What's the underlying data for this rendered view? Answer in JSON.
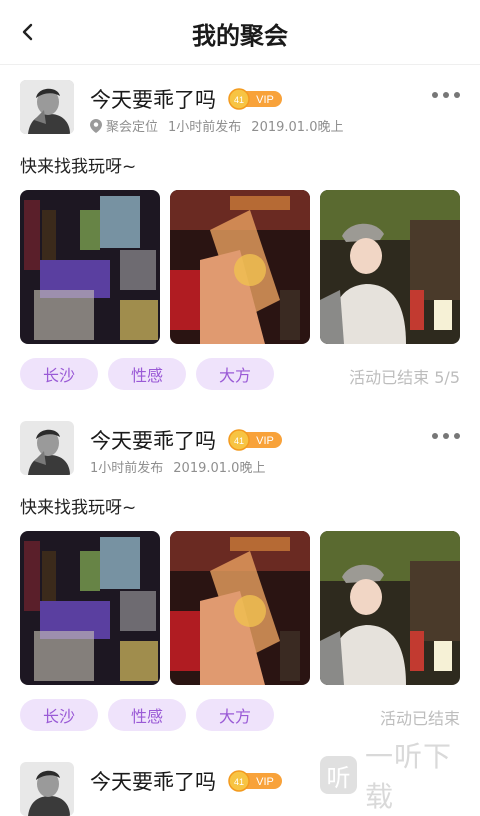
{
  "header": {
    "title": "我的聚会"
  },
  "posts": [
    {
      "name": "今天要乖了吗",
      "vip_label": "VIP",
      "vip_level": "41",
      "location": "聚会定位",
      "time": "1小时前发布",
      "date": "2019.01.0晚上",
      "text": "快来找我玩呀~",
      "tags": [
        "长沙",
        "性感",
        "大方"
      ],
      "status": "活动已结束 5/5"
    },
    {
      "name": "今天要乖了吗",
      "vip_label": "VIP",
      "vip_level": "41",
      "time": "1小时前发布",
      "date": "2019.01.0晚上",
      "text": "快来找我玩呀~",
      "tags": [
        "长沙",
        "性感",
        "大方"
      ],
      "status": "活动已结束"
    },
    {
      "name": "今天要乖了吗",
      "vip_label": "VIP",
      "vip_level": "41"
    }
  ],
  "watermark": {
    "logo_char": "听",
    "text": "一听下载"
  }
}
